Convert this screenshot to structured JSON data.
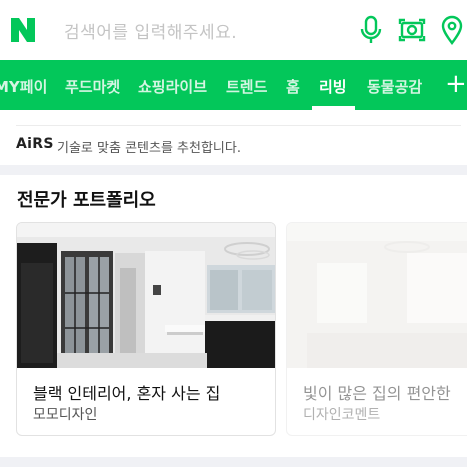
{
  "header": {
    "logo_letter": "N",
    "search_placeholder": "검색어를 입력해주세요.",
    "icons": [
      "microphone-icon",
      "lens-camera-icon",
      "location-icon"
    ],
    "brand_color": "#03c75a"
  },
  "nav": {
    "tabs": [
      {
        "label": "MY페이",
        "active": false
      },
      {
        "label": "푸드마켓",
        "active": false
      },
      {
        "label": "쇼핑라이브",
        "active": false
      },
      {
        "label": "트렌드",
        "active": false
      },
      {
        "label": "홈",
        "active": false
      },
      {
        "label": "리빙",
        "active": true
      },
      {
        "label": "동물공감",
        "active": false
      }
    ],
    "plus_label": "+"
  },
  "airs": {
    "logo": "AiRS",
    "text": "기술로 맞춤 콘텐츠를 추천합니다."
  },
  "section": {
    "title": "전문가 포트폴리오",
    "cards": [
      {
        "title": "블랙 인테리어, 혼자 사는 집",
        "author": "모모디자인"
      },
      {
        "title": "빛이 많은 집의 편안한",
        "author": "디자인코멘트"
      }
    ]
  }
}
